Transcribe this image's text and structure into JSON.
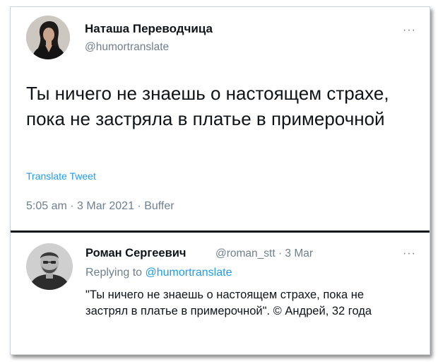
{
  "tweet": {
    "author_name": "Наташа Переводчица",
    "handle": "@humortranslate",
    "more": "···",
    "text": "Ты ничего не знаешь о настоящем страхе, пока не застряла в платье в примерочной",
    "translate_label": "Translate Tweet",
    "meta": "5:05 am · 3 Mar 2021 · Buffer"
  },
  "reply": {
    "author_name": "Роман Сергеевич",
    "handle_date": "@roman_stt · 3 Mar",
    "more": "···",
    "replying_prefix": "Replying to ",
    "replying_handle": "@humortranslate",
    "text": "\"Ты ничего не знаешь о настоящем страхе, пока не застрял в платье в примерочной\". © Андрей, 32 года"
  },
  "colors": {
    "link": "#1d9bf0",
    "muted": "#6e7f8d",
    "divider": "#0f1419"
  },
  "icons": {
    "more": "more-dots-icon"
  }
}
